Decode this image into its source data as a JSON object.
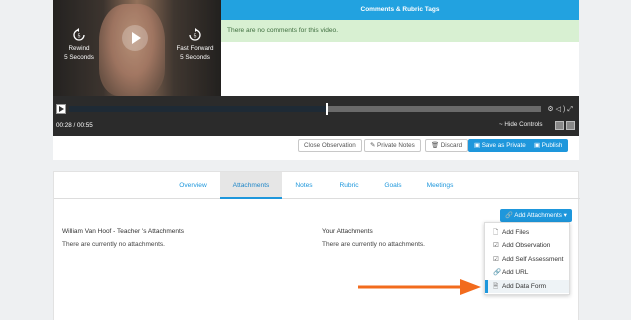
{
  "video": {
    "rewind_label_1": "Rewind",
    "rewind_label_2": "5 Seconds",
    "ff_label_1": "Fast Forward",
    "ff_label_2": "5 Seconds",
    "time": "00:28 / 00:55",
    "progress": 0.545,
    "hide_controls": "~ Hide Controls"
  },
  "comments": {
    "header": "Comments & Rubric Tags",
    "empty_text": "There are no comments for this video."
  },
  "actions": {
    "close_observation": "Close Observation",
    "private_notes": "Private Notes",
    "discard": "Discard",
    "save_private": "Save as Private",
    "publish": "Publish"
  },
  "tabs": [
    "Overview",
    "Attachments",
    "Notes",
    "Rubric",
    "Goals",
    "Meetings"
  ],
  "active_tab": "Attachments",
  "attachments": {
    "add_button": "Add Attachments",
    "left_title": "William Van Hoof - Teacher 's Attachments",
    "left_empty": "There are currently no attachments.",
    "right_title": "Your Attachments",
    "right_empty": "There are currently no attachments."
  },
  "add_menu": [
    {
      "label": "Add Files",
      "icon": "file-icon"
    },
    {
      "label": "Add Observation",
      "icon": "checkbox-icon"
    },
    {
      "label": "Add Self Assessment",
      "icon": "checkbox-icon"
    },
    {
      "label": "Add URL",
      "icon": "link-icon"
    },
    {
      "label": "Add Data Form",
      "icon": "form-icon"
    }
  ],
  "colors": {
    "accent": "#1e97dc",
    "success_bg": "#d8f0d2",
    "arrow": "#f26b1d"
  }
}
